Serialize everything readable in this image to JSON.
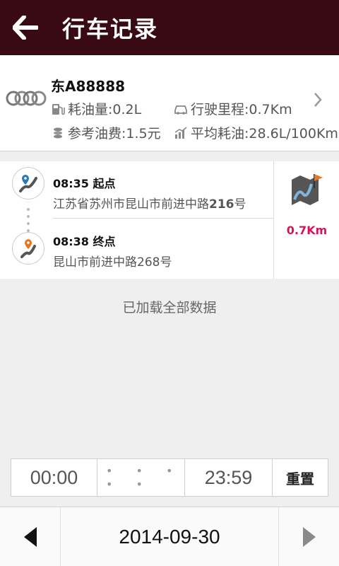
{
  "header": {
    "title": "行车记录",
    "back_icon": "back-arrow-icon"
  },
  "car": {
    "plate": "东A88888",
    "fuel_used": "耗油量:0.2L",
    "mileage": "行驶里程:0.7Km",
    "fuel_cost": "参考油费:1.5元",
    "avg_consumption": "平均耗油:28.6L/100Km"
  },
  "trip": {
    "start_time": "08:35",
    "start_label": "起点",
    "start_address_prefix": "江苏省苏州市昆山市前进中路",
    "start_address_number": "216",
    "start_address_suffix": "号",
    "end_time": "08:38",
    "end_label": "终点",
    "end_address": "昆山市前进中路268号",
    "distance": "0.7Km"
  },
  "status": {
    "loaded_text": "已加载全部数据"
  },
  "time_filter": {
    "start": "00:00",
    "dots": "• • • • •",
    "end": "23:59",
    "reset_label": "重置"
  },
  "footer": {
    "date": "2014-09-30"
  },
  "colors": {
    "header_bg": "#3a0a14",
    "distance": "#d4145a",
    "start_pin": "#2a7ab8",
    "end_pin": "#e87722"
  }
}
